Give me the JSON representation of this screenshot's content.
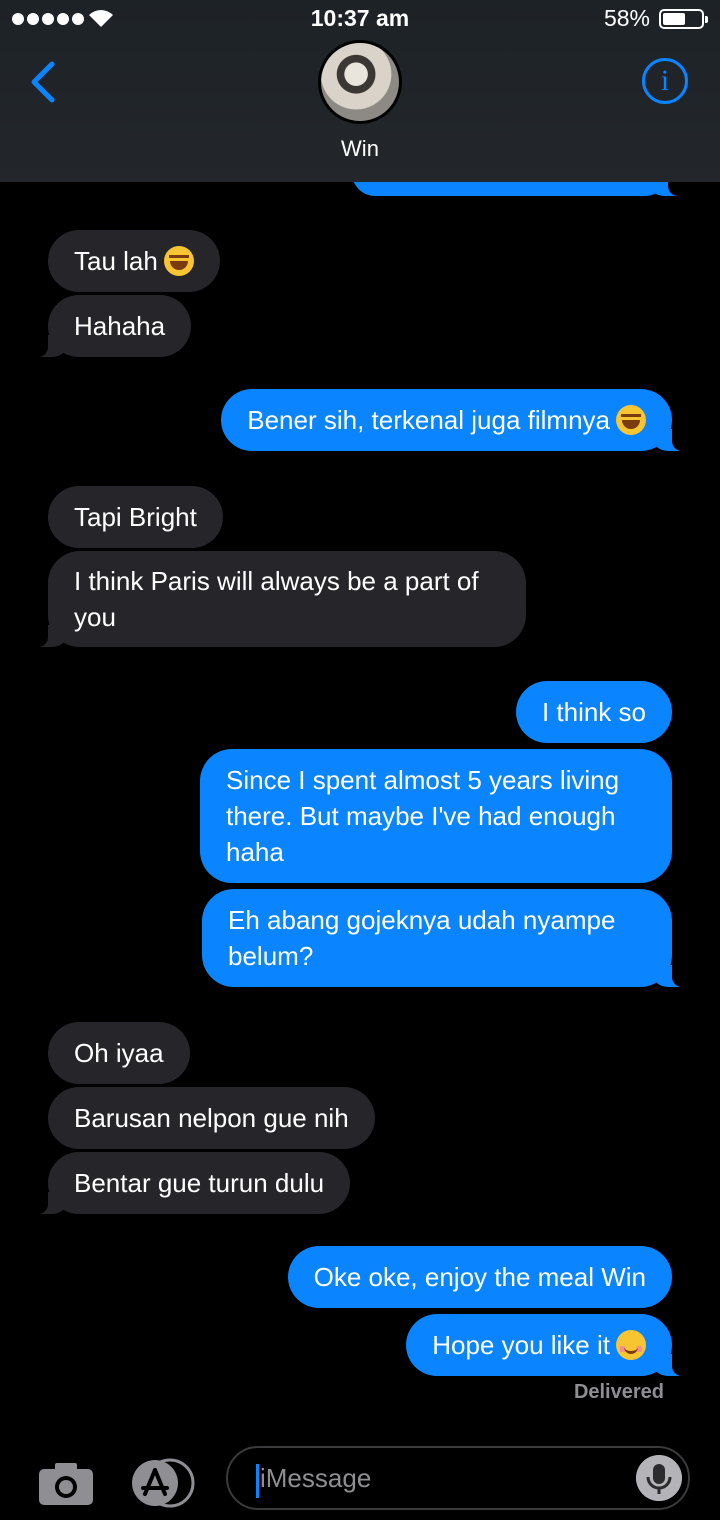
{
  "status_bar": {
    "time": "10:37 am",
    "battery": "58%"
  },
  "header": {
    "contact_name": "Win"
  },
  "messages": [
    {
      "text": "Tau lah",
      "emoji": "face-with-tears-of-joy"
    },
    {
      "text": "Hahaha"
    },
    {
      "text": "Bener sih, terkenal juga filmnya",
      "emoji": "face-with-tears-of-joy"
    },
    {
      "text": "Tapi Bright"
    },
    {
      "text": "I think Paris will always be a part of you"
    },
    {
      "text": "I think so"
    },
    {
      "text": "Since I spent almost 5 years living there. But maybe I've had enough haha"
    },
    {
      "text": "Eh abang gojeknya udah nyampe belum?"
    },
    {
      "text": "Oh iyaa"
    },
    {
      "text": "Barusan nelpon gue nih"
    },
    {
      "text": "Bentar gue turun dulu"
    },
    {
      "text": "Oke oke, enjoy the meal Win"
    },
    {
      "text": "Hope you like it",
      "emoji": "smiling-face"
    }
  ],
  "delivered": "Delivered",
  "composer": {
    "placeholder": "iMessage"
  },
  "colors": {
    "outgoing": "#0a84ff",
    "incoming": "#26252a",
    "background": "#000000"
  },
  "icons": [
    "signal-dots-icon",
    "wifi-icon",
    "battery-icon",
    "back-chevron-icon",
    "info-icon",
    "camera-icon",
    "app-store-icon",
    "microphone-icon"
  ]
}
